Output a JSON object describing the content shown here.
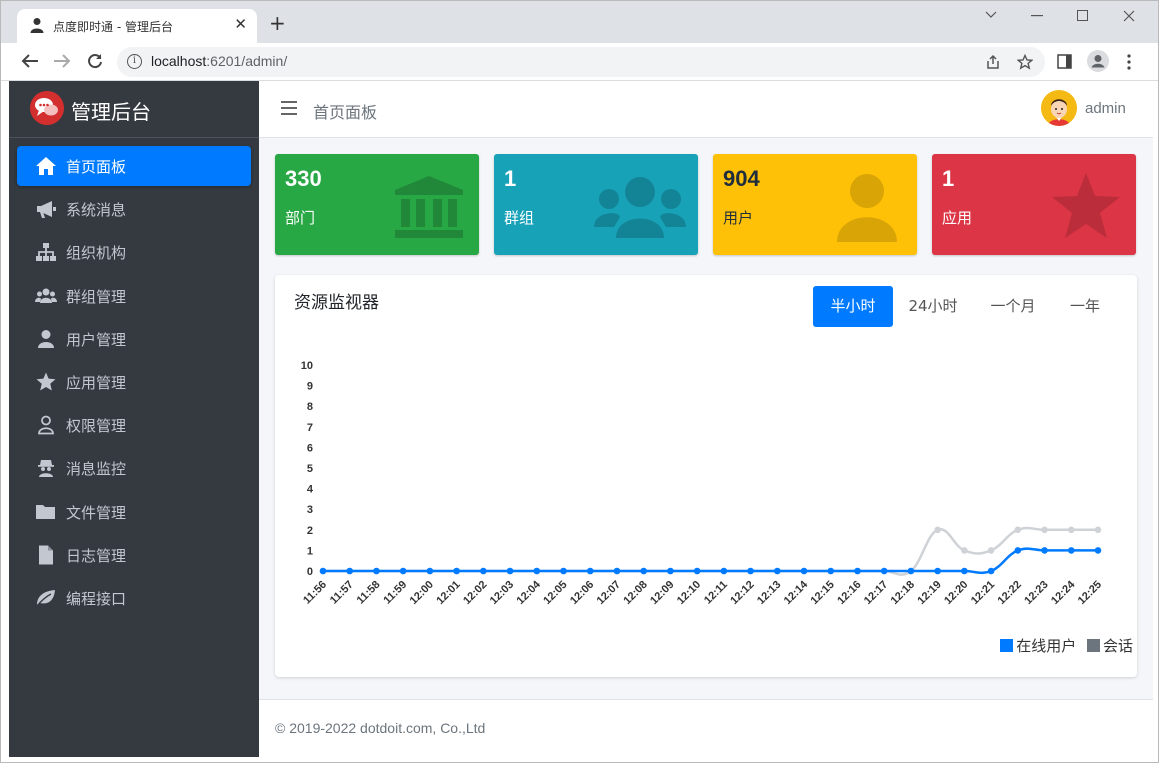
{
  "browser": {
    "tab_title": "点度即时通 - 管理后台",
    "url_host": "localhost",
    "url_path": ":6201/admin/",
    "close_glyph": "✕",
    "new_tab_glyph": "+"
  },
  "brand": {
    "title": "管理后台"
  },
  "sidebar": {
    "items": [
      {
        "label": "首页面板",
        "icon": "home-icon",
        "active": true
      },
      {
        "label": "系统消息",
        "icon": "bullhorn-icon"
      },
      {
        "label": "组织机构",
        "icon": "sitemap-icon"
      },
      {
        "label": "群组管理",
        "icon": "users-icon"
      },
      {
        "label": "用户管理",
        "icon": "user-icon"
      },
      {
        "label": "应用管理",
        "icon": "star-icon"
      },
      {
        "label": "权限管理",
        "icon": "user-outline-icon"
      },
      {
        "label": "消息监控",
        "icon": "spy-icon"
      },
      {
        "label": "文件管理",
        "icon": "folder-icon"
      },
      {
        "label": "日志管理",
        "icon": "file-icon"
      },
      {
        "label": "编程接口",
        "icon": "leaf-icon"
      }
    ]
  },
  "header": {
    "breadcrumb": "首页面板",
    "username": "admin"
  },
  "cards": [
    {
      "value": "330",
      "label": "部门",
      "color": "#28a745",
      "icon": "bank-icon"
    },
    {
      "value": "1",
      "label": "群组",
      "color": "#17a2b8",
      "icon": "users-icon"
    },
    {
      "value": "904",
      "label": "用户",
      "color": "#ffc107",
      "icon": "user-icon"
    },
    {
      "value": "1",
      "label": "应用",
      "color": "#dc3545",
      "icon": "star-icon"
    }
  ],
  "monitor": {
    "title": "资源监视器",
    "ranges": [
      "半小时",
      "24小时",
      "一个月",
      "一年"
    ],
    "active_range": "半小时"
  },
  "chart_data": {
    "type": "line",
    "x": [
      "11:56",
      "11:57",
      "11:58",
      "11:59",
      "12:00",
      "12:01",
      "12:02",
      "12:03",
      "12:04",
      "12:05",
      "12:06",
      "12:07",
      "12:08",
      "12:09",
      "12:10",
      "12:11",
      "12:12",
      "12:13",
      "12:14",
      "12:15",
      "12:16",
      "12:17",
      "12:18",
      "12:19",
      "12:20",
      "12:21",
      "12:22",
      "12:23",
      "12:24",
      "12:25"
    ],
    "ylim": [
      0,
      10
    ],
    "yticks": [
      0,
      1,
      2,
      3,
      4,
      5,
      6,
      7,
      8,
      9,
      10
    ],
    "legend": "bottom-right",
    "series": [
      {
        "name": "在线用户",
        "color": "#007bff",
        "values": [
          0,
          0,
          0,
          0,
          0,
          0,
          0,
          0,
          0,
          0,
          0,
          0,
          0,
          0,
          0,
          0,
          0,
          0,
          0,
          0,
          0,
          0,
          0,
          0,
          0,
          0,
          1,
          1,
          1,
          1
        ]
      },
      {
        "name": "会话",
        "color": "#cfd2d6",
        "legend_color": "#6c757d",
        "values": [
          0,
          0,
          0,
          0,
          0,
          0,
          0,
          0,
          0,
          0,
          0,
          0,
          0,
          0,
          0,
          0,
          0,
          0,
          0,
          0,
          0,
          0,
          0,
          2,
          1,
          1,
          2,
          2,
          2,
          2
        ]
      }
    ]
  },
  "footer": {
    "copyright": "© 2019-2022 dotdoit.com, Co.,Ltd"
  }
}
